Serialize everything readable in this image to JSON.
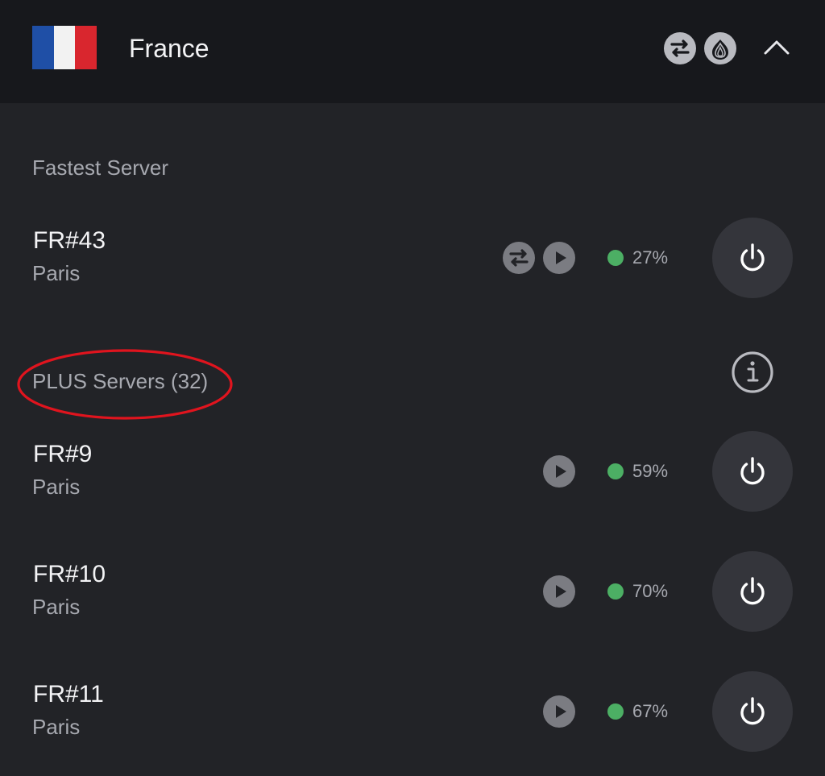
{
  "header": {
    "country": "France",
    "flag_colors": [
      "#1f4fa6",
      "#f2f2f2",
      "#d9262e"
    ],
    "icons": [
      "p2p-icon",
      "tor-icon"
    ],
    "collapse_icon": "chevron-up-icon"
  },
  "sections": {
    "fastest_label": "Fastest Server",
    "plus_label": "PLUS Servers (32)",
    "plus_info_icon": "info-icon"
  },
  "fastest_server": {
    "name": "FR#43",
    "city": "Paris",
    "features": [
      "p2p-icon",
      "streaming-icon"
    ],
    "load": "27%"
  },
  "plus_servers": [
    {
      "name": "FR#9",
      "city": "Paris",
      "features": [
        "streaming-icon"
      ],
      "load": "59%"
    },
    {
      "name": "FR#10",
      "city": "Paris",
      "features": [
        "streaming-icon"
      ],
      "load": "70%"
    },
    {
      "name": "FR#11",
      "city": "Paris",
      "features": [
        "streaming-icon"
      ],
      "load": "67%"
    }
  ],
  "colors": {
    "load_ok": "#4caf64",
    "annotation": "#e0141e",
    "background": "#222327",
    "header_bg": "#17181c"
  }
}
